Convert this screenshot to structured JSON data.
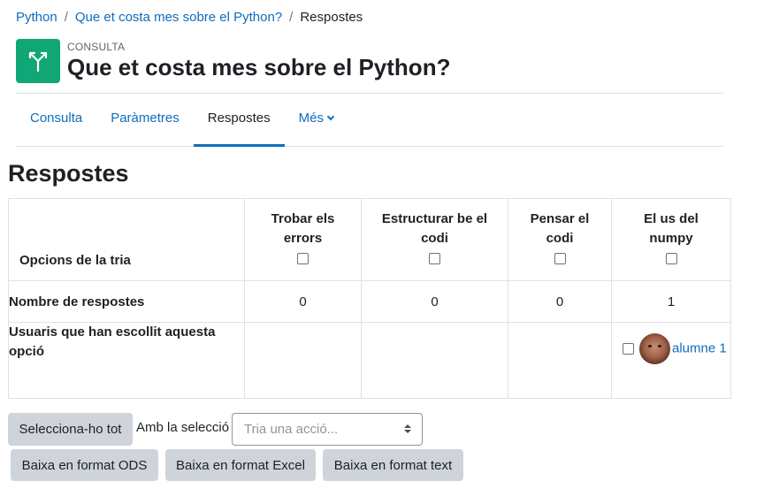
{
  "breadcrumb": {
    "items": [
      "Python",
      "Que et costa mes sobre el Python?"
    ],
    "current": "Respostes",
    "separator": "/"
  },
  "header": {
    "activity_type": "CONSULTA",
    "title": "Que et costa mes sobre el Python?",
    "icon": "choice-icon",
    "icon_color": "#11a676"
  },
  "tabs": [
    {
      "label": "Consulta",
      "active": false
    },
    {
      "label": "Paràmetres",
      "active": false
    },
    {
      "label": "Respostes",
      "active": true
    },
    {
      "label": "Més",
      "active": false,
      "dropdown": true
    }
  ],
  "section_title": "Respostes",
  "table": {
    "row_labels": {
      "options": "Opcions de la tria",
      "count": "Nombre de respostes",
      "users": "Usuaris que han escollit aquesta opció"
    },
    "options": [
      {
        "name": "Trobar els errors",
        "count": "0",
        "users": []
      },
      {
        "name": "Estructurar be el codi",
        "count": "0",
        "users": []
      },
      {
        "name": "Pensar el codi",
        "count": "0",
        "users": []
      },
      {
        "name": "El us del numpy",
        "count": "1",
        "users": [
          {
            "name": "alumne 1",
            "avatar": "avatar-photo"
          }
        ]
      }
    ]
  },
  "actions": {
    "select_all": "Selecciona-ho tot",
    "with_selection": "Amb la selecció",
    "action_placeholder": "Tria una acció...",
    "download_ods": "Baixa en format ODS",
    "download_excel": "Baixa en format Excel",
    "download_text": "Baixa en format text"
  },
  "colors": {
    "link": "#0f6cbf",
    "button_bg": "#ced4da",
    "accent_green": "#11a676"
  }
}
